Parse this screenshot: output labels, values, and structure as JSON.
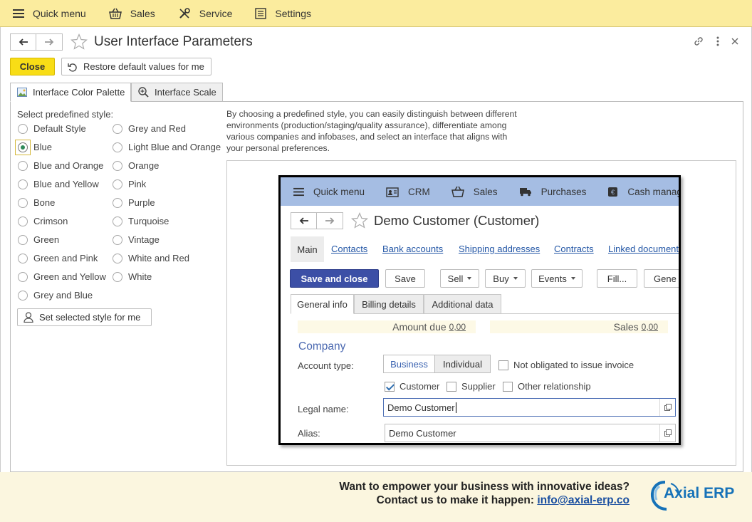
{
  "topbar": {
    "items": [
      {
        "label": "Quick menu",
        "icon": "hamburger-icon"
      },
      {
        "label": "Sales",
        "icon": "basket-icon"
      },
      {
        "label": "Service",
        "icon": "tools-icon"
      },
      {
        "label": "Settings",
        "icon": "settings-icon"
      }
    ]
  },
  "window": {
    "title": "User Interface Parameters",
    "close_label": "Close",
    "restore_label": "Restore default values for me",
    "tabs": [
      {
        "label": "Interface Color Palette",
        "icon": "palette-image-icon"
      },
      {
        "label": "Interface Scale",
        "icon": "zoom-icon"
      }
    ]
  },
  "palette": {
    "select_label": "Select predefined style:",
    "styles_left": [
      "Default Style",
      "Blue",
      "Blue and Orange",
      "Blue and Yellow",
      "Bone",
      "Crimson",
      "Green",
      "Green and Pink",
      "Green and Yellow",
      "Grey and Blue"
    ],
    "styles_right": [
      "Grey and Red",
      "Light Blue and Orange",
      "Orange",
      "Pink",
      "Purple",
      "Turquoise",
      "Vintage",
      "White and Red",
      "White"
    ],
    "selected_style": "Blue",
    "set_button_label": "Set selected style for me",
    "description": "By choosing a predefined style, you can easily distinguish between different environments (production/staging/quality assurance), differentiate among various companies and infobases, and select an interface that aligns with your personal preferences."
  },
  "preview": {
    "bar_color": "#a5bde3",
    "bar_items": [
      {
        "label": "Quick menu",
        "icon": "hamburger-icon"
      },
      {
        "label": "CRM",
        "icon": "contact-card-icon"
      },
      {
        "label": "Sales",
        "icon": "basket-icon"
      },
      {
        "label": "Purchases",
        "icon": "truck-icon"
      },
      {
        "label": "Cash manag",
        "icon": "cash-icon"
      }
    ],
    "title": "Demo Customer (Customer)",
    "main_tab": "Main",
    "links": [
      "Contacts",
      "Bank accounts",
      "Shipping addresses",
      "Contracts",
      "Linked document"
    ],
    "buttons": {
      "save_close": "Save and close",
      "save": "Save",
      "sell": "Sell",
      "buy": "Buy",
      "events": "Events",
      "fill": "Fill...",
      "gene": "Gene"
    },
    "tabs": [
      "General info",
      "Billing details",
      "Additional data"
    ],
    "amount_due_label": "Amount due",
    "amount_due_value": "0,00",
    "sales_label": "Sales",
    "sales_value": "0,00",
    "section": "Company",
    "account_type_label": "Account type:",
    "account_types": [
      "Business",
      "Individual"
    ],
    "not_obligated_label": "Not obligated to issue invoice",
    "relations": [
      {
        "label": "Customer",
        "checked": true
      },
      {
        "label": "Supplier",
        "checked": false
      },
      {
        "label": "Other relationship",
        "checked": false
      }
    ],
    "legal_name_label": "Legal name:",
    "legal_name_value": "Demo Customer",
    "alias_label": "Alias:",
    "alias_value": "Demo Customer"
  },
  "promo": {
    "line1": "Want to empower your business with innovative ideas?",
    "line2_prefix": "Contact us to make it happen:",
    "email": "info@axial-erp.co",
    "logo_text": "Axial ERP"
  }
}
